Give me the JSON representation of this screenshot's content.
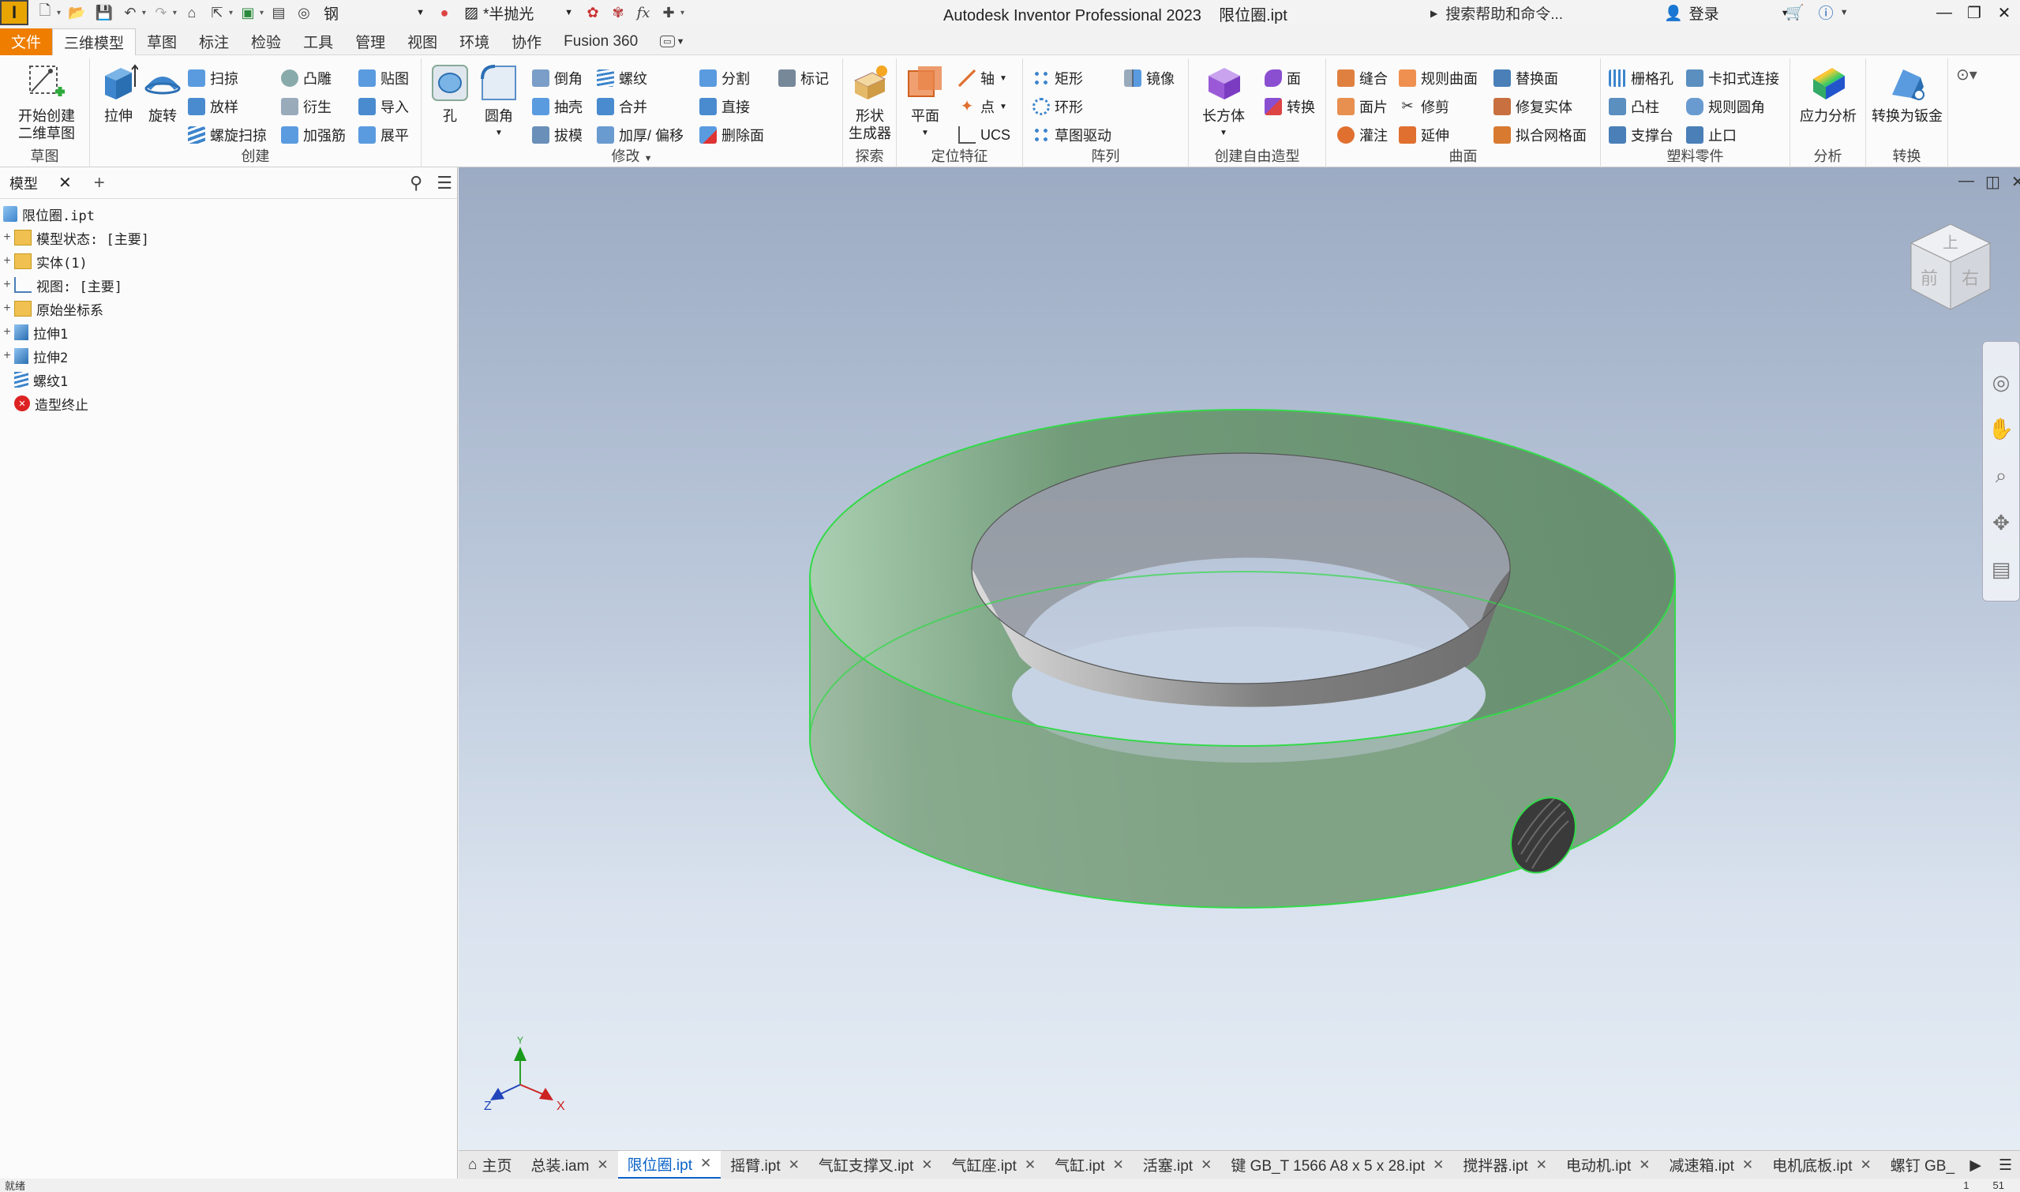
{
  "titlebar": {
    "logo": "I",
    "material": "钢",
    "appearance": "*半抛光",
    "fx": "fx",
    "title": "Autodesk Inventor Professional 2023",
    "filename": "限位圈.ipt",
    "help_search": "搜索帮助和命令...",
    "login": "登录"
  },
  "tabs": [
    "文件",
    "三维模型",
    "草图",
    "标注",
    "检验",
    "工具",
    "管理",
    "视图",
    "环境",
    "协作",
    "Fusion 360"
  ],
  "active_tab": "三维模型",
  "ribbon": {
    "sketch": {
      "label": "草图",
      "start_sketch": "开始创建",
      "start_sketch2": "二维草图"
    },
    "create": {
      "label": "创建",
      "extrude": "拉伸",
      "revolve": "旋转",
      "sweep": "扫掠",
      "loft": "放样",
      "coil": "螺旋扫掠",
      "emboss": "凸雕",
      "derive": "衍生",
      "rib": "加强筋",
      "decal": "贴图",
      "import": "导入",
      "unwrap": "展平"
    },
    "modify": {
      "label": "修改",
      "hole": "孔",
      "fillet": "圆角",
      "chamfer": "倒角",
      "shell": "抽壳",
      "draft": "拔模",
      "thread": "螺纹",
      "combine": "合并",
      "thicken": "加厚/ 偏移",
      "split": "分割",
      "direct": "直接",
      "delete_face": "删除面",
      "mark": "标记"
    },
    "explore": {
      "label": "探索",
      "shape_gen": "形状",
      "shape_gen2": "生成器"
    },
    "work_features": {
      "label": "定位特征",
      "plane": "平面",
      "axis": "轴",
      "point": "点",
      "ucs": "UCS"
    },
    "pattern": {
      "label": "阵列",
      "rect": "矩形",
      "circ": "环形",
      "sketch_driven": "草图驱动",
      "mirror": "镜像"
    },
    "freeform": {
      "label": "创建自由造型",
      "box": "长方体",
      "face": "面",
      "convert": "转换"
    },
    "surface": {
      "label": "曲面",
      "stitch": "缝合",
      "patch": "面片",
      "sculpt": "灌注",
      "ruled": "规则曲面",
      "trim": "修剪",
      "extend": "延伸",
      "replace": "替换面",
      "repair": "修复实体",
      "fit_mesh": "拟合网格面"
    },
    "plastic": {
      "label": "塑料零件",
      "grill": "栅格孔",
      "boss": "凸柱",
      "rest": "支撑台",
      "snap_fit": "卡扣式连接",
      "rule_fillet": "规则圆角",
      "lip": "止口"
    },
    "analysis": {
      "label": "分析",
      "stress": "应力分析"
    },
    "convert": {
      "label": "转换",
      "to_sheetmetal": "转换为钣金"
    }
  },
  "browser": {
    "tab_label": "模型",
    "items": [
      {
        "label": "限位圈.ipt"
      },
      {
        "label": "模型状态: [主要]"
      },
      {
        "label": "实体(1)"
      },
      {
        "label": "视图: [主要]"
      },
      {
        "label": "原始坐标系"
      },
      {
        "label": "拉伸1"
      },
      {
        "label": "拉伸2"
      },
      {
        "label": "螺纹1"
      },
      {
        "label": "造型终止"
      }
    ]
  },
  "viewcube": {
    "front": "前",
    "top": "上",
    "right": "右"
  },
  "triad": {
    "x": "X",
    "y": "Y",
    "z": "Z"
  },
  "doc_tabs": [
    {
      "label": "主页"
    },
    {
      "label": "总装.iam"
    },
    {
      "label": "限位圈.ipt",
      "active": true
    },
    {
      "label": "摇臂.ipt"
    },
    {
      "label": "气缸支撑叉.ipt"
    },
    {
      "label": "气缸座.ipt"
    },
    {
      "label": "气缸.ipt"
    },
    {
      "label": "活塞.ipt"
    },
    {
      "label": "键 GB_T 1566 A8 x 5 x 28.ipt"
    },
    {
      "label": "搅拌器.ipt"
    },
    {
      "label": "电动机.ipt"
    },
    {
      "label": "减速箱.ipt"
    },
    {
      "label": "电机底板.ipt"
    },
    {
      "label": "螺钉 GB_"
    }
  ],
  "status": {
    "left": "就绪",
    "page1": "1",
    "page2": "51"
  },
  "colors": {
    "accent": "#ef7d00",
    "selection": "#34d94a",
    "part": "#7a9e7e",
    "active_tab": "#0a62c9"
  }
}
